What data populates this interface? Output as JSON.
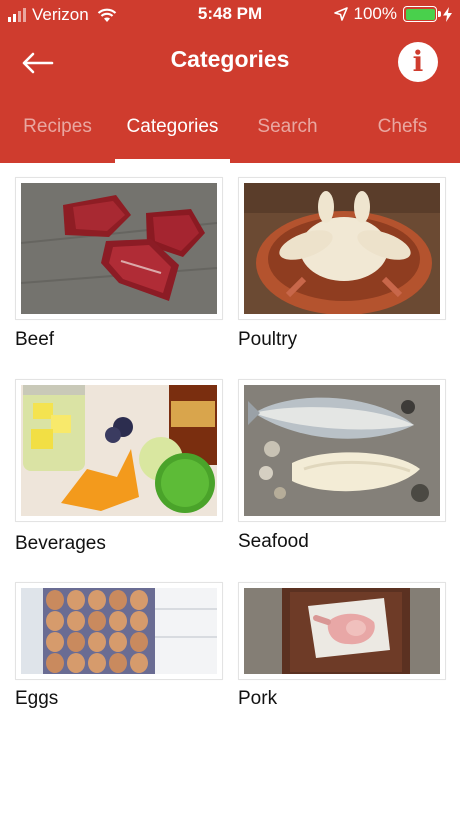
{
  "status_bar": {
    "carrier": "Verizon",
    "time": "5:48 PM",
    "battery_percent": "100%",
    "battery_level": 1.0,
    "battery_color": "#49d04c"
  },
  "header": {
    "title": "Categories",
    "accent_color": "#cf3c2e",
    "back_icon": "arrow-left-icon",
    "info_icon": "info-icon"
  },
  "tabs": [
    {
      "label": "Recipes",
      "active": false
    },
    {
      "label": "Categories",
      "active": true
    },
    {
      "label": "Search",
      "active": false
    },
    {
      "label": "Chefs",
      "active": false
    }
  ],
  "categories": [
    {
      "label": "Beef",
      "image": "raw beef steaks on slate"
    },
    {
      "label": "Poultry",
      "image": "raw whole chicken in clay dish"
    },
    {
      "label": "Beverages",
      "image": "pineapple, limes, orange peel and bottle"
    },
    {
      "label": "Seafood",
      "image": "whole fish and fillet with oysters"
    },
    {
      "label": "Eggs",
      "image": "brown eggs in carton"
    },
    {
      "label": "Pork",
      "image": "pork chop on paper in wooden tray"
    }
  ]
}
